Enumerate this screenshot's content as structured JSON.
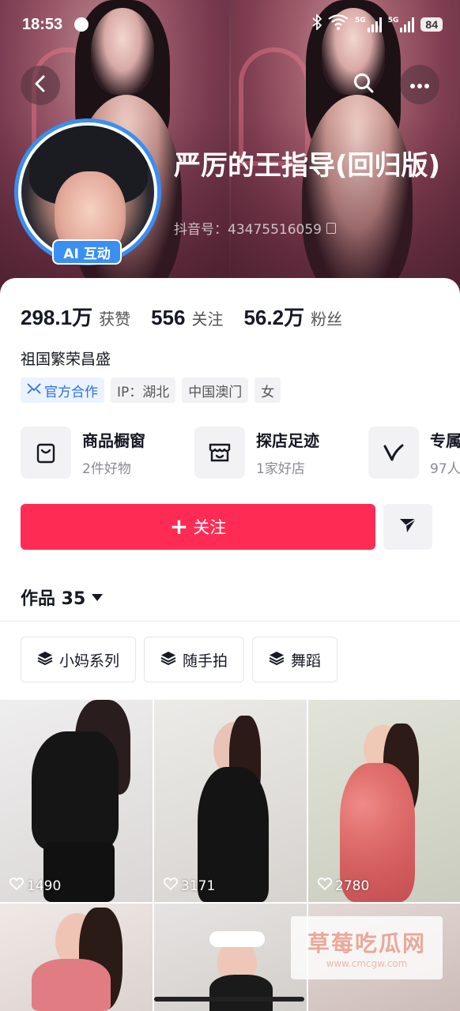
{
  "status_bar": {
    "time": "18:53",
    "network1": "5G",
    "network2": "5G",
    "battery": "84"
  },
  "profile": {
    "name": "严厉的王指导(回归版)",
    "douyin_id": "抖音号：43475516059",
    "ai_badge": "AI 互动",
    "bio": "祖国繁荣昌盛"
  },
  "stats": [
    {
      "num": "298.1万",
      "label": "获赞"
    },
    {
      "num": "556",
      "label": "关注"
    },
    {
      "num": "56.2万",
      "label": "粉丝"
    }
  ],
  "tags": [
    {
      "label": "官方合作"
    },
    {
      "label": "IP：湖北"
    },
    {
      "label": "中国澳门"
    },
    {
      "label": "女"
    }
  ],
  "shortcuts": [
    {
      "title": "商品橱窗",
      "sub": "2件好物",
      "icon": "shopping-bag-icon"
    },
    {
      "title": "探店足迹",
      "sub": "1家好店",
      "icon": "store-icon"
    },
    {
      "title": "专属",
      "sub": "97人",
      "icon": "v-icon"
    }
  ],
  "actions": {
    "follow": "关注"
  },
  "works": {
    "label": "作品 35"
  },
  "collections": [
    {
      "label": "小妈系列"
    },
    {
      "label": "随手拍"
    },
    {
      "label": "舞蹈"
    }
  ],
  "videos": [
    {
      "likes": "1490"
    },
    {
      "likes": "3171"
    },
    {
      "likes": "2780"
    }
  ],
  "watermark": {
    "title": "草莓吃瓜网",
    "url": "www.cmcgw.com"
  },
  "colors": {
    "follow_red": "#fe2c55",
    "ai_blue": "#3b8ff0",
    "official_blue": "#2f6fe0"
  }
}
